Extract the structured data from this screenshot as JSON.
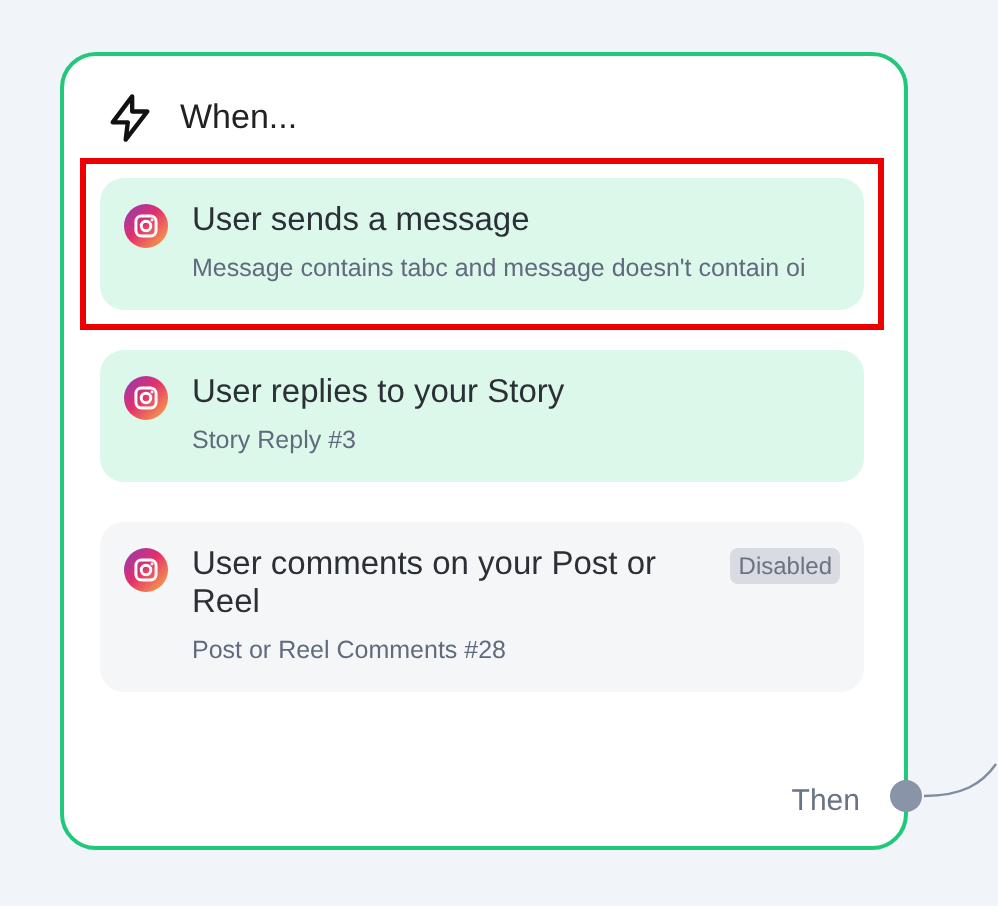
{
  "header": {
    "title": "When..."
  },
  "triggers": [
    {
      "title": "User sends a message",
      "subtitle": "Message contains tabc and message doesn't contain oi",
      "disabled": false,
      "highlighted": true
    },
    {
      "title": "User replies to your Story",
      "subtitle": "Story Reply #3",
      "disabled": false,
      "highlighted": false
    },
    {
      "title": "User comments on your Post or Reel",
      "subtitle": "Post or Reel Comments #28",
      "disabled": true,
      "badge": "Disabled",
      "highlighted": false
    }
  ],
  "footer": {
    "label": "Then"
  }
}
